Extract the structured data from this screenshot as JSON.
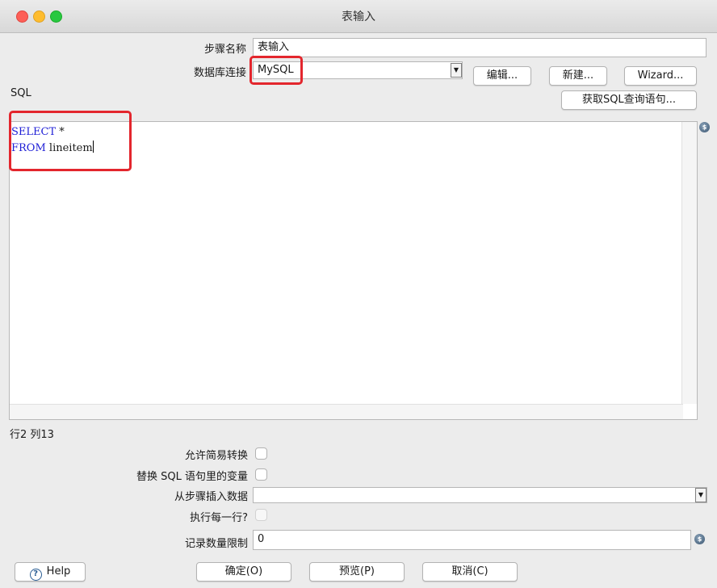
{
  "window": {
    "title": "表输入"
  },
  "form": {
    "step_name_label": "步骤名称",
    "step_name_value": "表输入",
    "connection_label": "数据库连接",
    "connection_value": "MySQL",
    "edit_label": "编辑...",
    "new_label": "新建...",
    "wizard_label": "Wizard...",
    "get_sql_label": "获取SQL查询语句...",
    "sql_label": "SQL"
  },
  "editor": {
    "line1_kw": "SELECT",
    "line1_rest": " *",
    "line2_kw": "FROM",
    "line2_rest": " lineitem",
    "cursor_pos": "行2 列13"
  },
  "options": {
    "lazy_conversion_label": "允许简易转换",
    "replace_vars_label": "替换 SQL 语句里的变量",
    "insert_from_step_label": "从步骤插入数据",
    "insert_from_step_value": "",
    "execute_each_row_label": "执行每一行?",
    "limit_label": "记录数量限制",
    "limit_value": "0"
  },
  "footer": {
    "help_label": "Help",
    "ok_label": "确定(O)",
    "preview_label": "预览(P)",
    "cancel_label": "取消(C)"
  },
  "colors": {
    "highlight": "#e3262d",
    "keyword": "#1f1fd6"
  },
  "icons": [
    "help-icon",
    "variable-icon",
    "dropdown-arrow-icon"
  ]
}
